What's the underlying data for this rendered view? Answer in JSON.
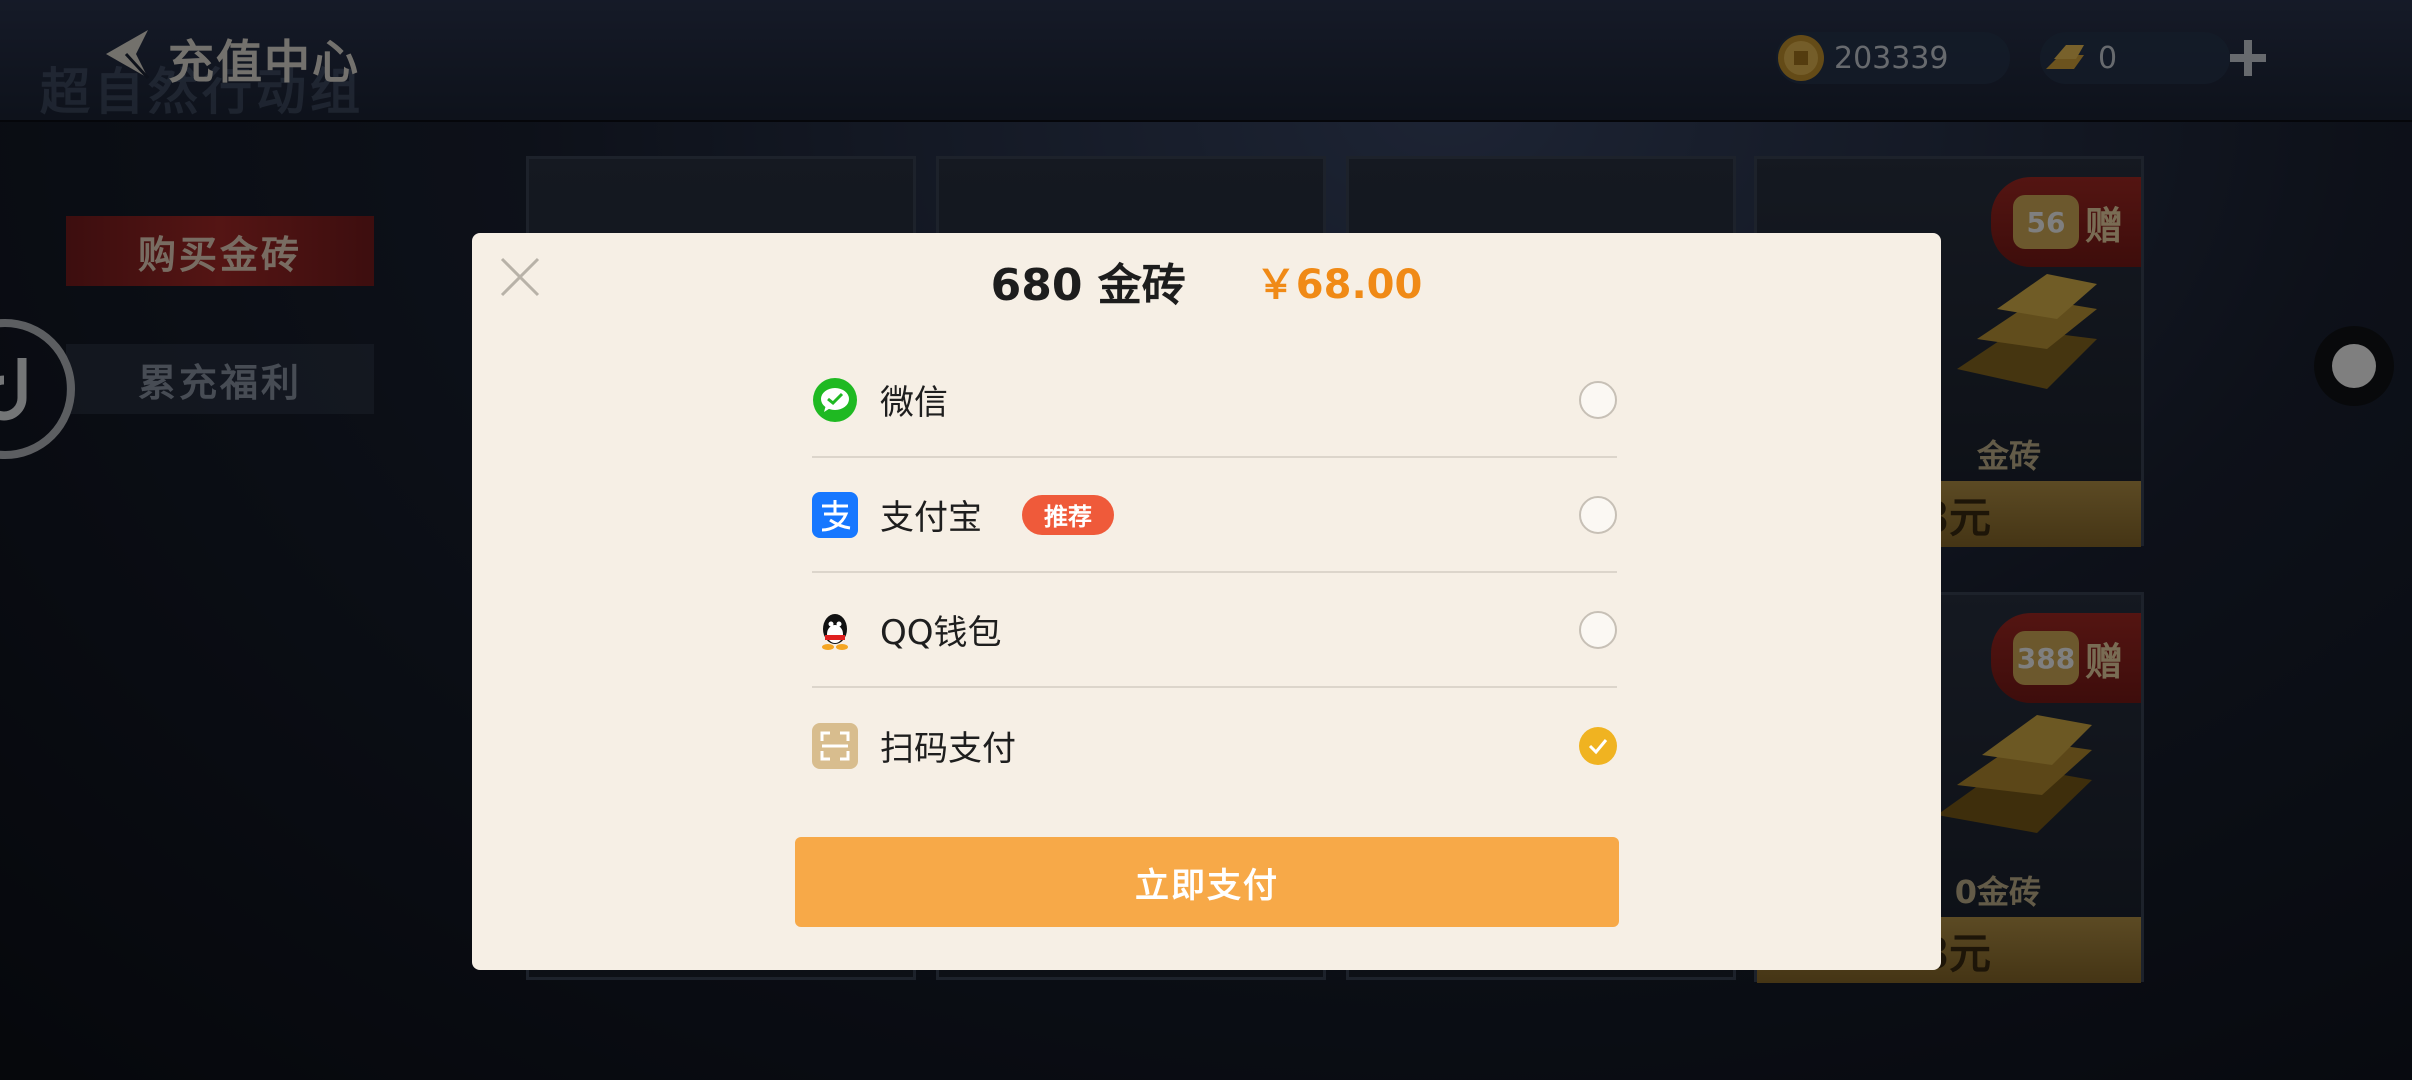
{
  "app": {
    "title": "充值中心",
    "ghost_subtitle": "超自然行动组"
  },
  "currency": {
    "coins": "203339",
    "gold": "0"
  },
  "side_tabs": [
    {
      "label": "购买金砖",
      "active": true
    },
    {
      "label": "累充福利",
      "active": false
    }
  ],
  "cards": [
    {
      "gift_label": "赠",
      "gift_amount": "56",
      "name": "金砖",
      "price": "8元"
    },
    {
      "gift_label": "赠",
      "gift_amount": "388",
      "name": "0金砖",
      "price": "8元"
    }
  ],
  "dialog": {
    "amount": "680 金砖",
    "price": "￥68.00",
    "methods": [
      {
        "label": "微信",
        "icon": "wechat-icon",
        "badge": "",
        "selected": false
      },
      {
        "label": "支付宝",
        "icon": "alipay-icon",
        "badge": "推荐",
        "selected": false
      },
      {
        "label": "QQ钱包",
        "icon": "qq-icon",
        "badge": "",
        "selected": false
      },
      {
        "label": "扫码支付",
        "icon": "scan-icon",
        "badge": "",
        "selected": true
      }
    ],
    "pay_button": "立即支付"
  },
  "colors": {
    "dialog_bg": "#f6efe5",
    "price": "#f08a16",
    "pay_button": "#f7a948",
    "check": "#f0b321",
    "badge": "#ef5a3a",
    "wechat": "#1fb922",
    "alipay": "#1677ff"
  }
}
